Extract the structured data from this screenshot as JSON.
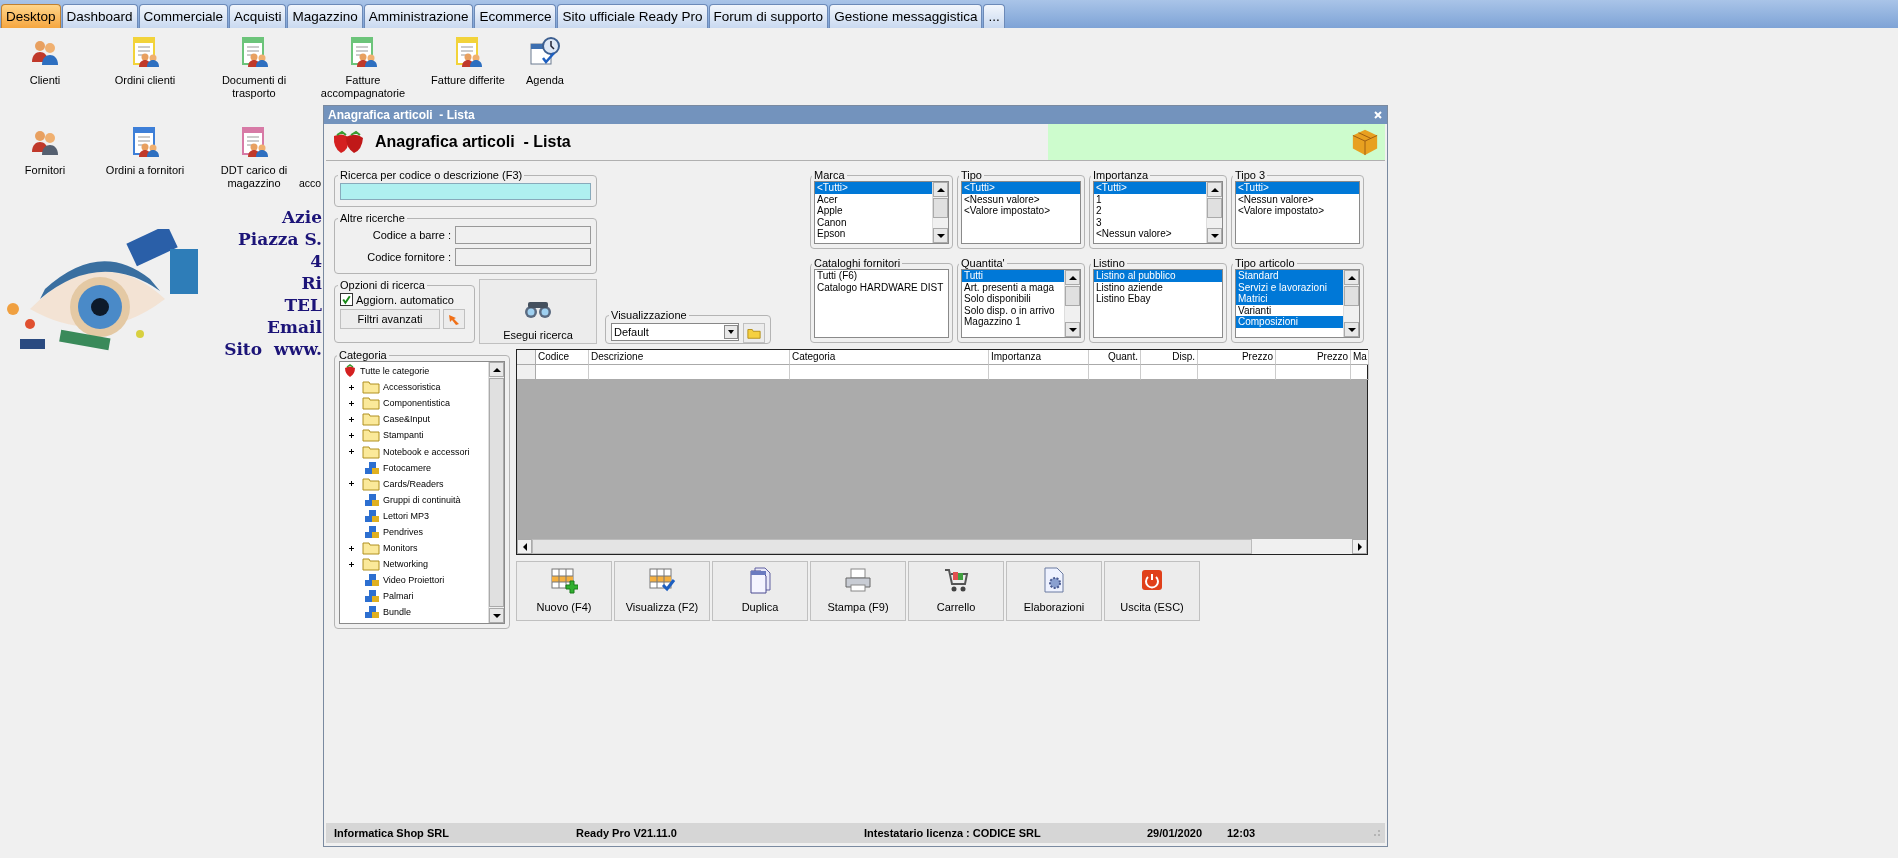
{
  "tabs": [
    {
      "label": "Desktop",
      "selected": true
    },
    {
      "label": "Dashboard",
      "selected": false
    },
    {
      "label": "Commerciale",
      "selected": false
    },
    {
      "label": "Acquisti",
      "selected": false
    },
    {
      "label": "Magazzino",
      "selected": false
    },
    {
      "label": "Amministrazione",
      "selected": false
    },
    {
      "label": "Ecommerce",
      "selected": false
    },
    {
      "label": "Sito ufficiale Ready Pro",
      "selected": false
    },
    {
      "label": "Forum di supporto",
      "selected": false
    },
    {
      "label": "Gestione messaggistica",
      "selected": false
    },
    {
      "label": "...",
      "selected": false
    }
  ],
  "desktop_icons": [
    {
      "label": "Clienti",
      "kind": "icon"
    },
    {
      "label": "Ordini clienti",
      "kind": "icon"
    },
    {
      "label": "Documenti di trasporto",
      "kind": "icon"
    },
    {
      "label": "Fatture accompagnatorie",
      "kind": "icon"
    },
    {
      "label": "Fatture differite",
      "kind": "icon"
    },
    {
      "label": "Agenda",
      "kind": "icon"
    },
    {
      "label": "Fornitori",
      "kind": "icon"
    },
    {
      "label": "Ordini a fornitori",
      "kind": "icon"
    },
    {
      "label": "DDT carico di magazzino",
      "kind": "icon"
    },
    {
      "label": "acco",
      "kind": "cut"
    }
  ],
  "company_banner": {
    "kind": "picture",
    "lines": [
      "Azie",
      "Piazza S.",
      "4",
      "Ri",
      "TEL",
      "Email",
      "Sito  www."
    ]
  },
  "window": {
    "title": "Anagrafica articoli  - Lista",
    "heading": "Anagrafica articoli  - Lista",
    "search": {
      "label": "Ricerca per codice o descrizione (F3)"
    },
    "other_searches": {
      "label": "Altre ricerche",
      "fields": [
        {
          "label": "Codice a barre :"
        },
        {
          "label": "Codice fornitore :"
        }
      ]
    },
    "options": {
      "label": "Opzioni di ricerca",
      "checkbox": {
        "label": "Aggiorn. automatico",
        "checked": true
      },
      "button": "Filtri avanzati"
    },
    "run_button": "Esegui ricerca",
    "view": {
      "label": "Visualizzazione",
      "value": "Default"
    },
    "filters": [
      {
        "title": "Marca",
        "kind": "scroll",
        "items": [
          {
            "label": "<Tutti>",
            "selected": true
          },
          {
            "label": "Acer",
            "selected": false
          },
          {
            "label": "Apple",
            "selected": false
          },
          {
            "label": "Canon",
            "selected": false
          },
          {
            "label": "Epson",
            "selected": false
          }
        ]
      },
      {
        "title": "Tipo",
        "kind": "plain",
        "items": [
          {
            "label": "<Tutti>",
            "selected": true
          },
          {
            "label": "<Nessun valore>",
            "selected": false
          },
          {
            "label": "<Valore impostato>",
            "selected": false
          }
        ]
      },
      {
        "title": "Importanza",
        "kind": "scroll",
        "items": [
          {
            "label": "<Tutti>",
            "selected": true
          },
          {
            "label": "1",
            "selected": false
          },
          {
            "label": "2",
            "selected": false
          },
          {
            "label": "3",
            "selected": false
          },
          {
            "label": "<Nessun valore>",
            "selected": false
          }
        ]
      },
      {
        "title": "Tipo 3",
        "kind": "plain",
        "items": [
          {
            "label": "<Tutti>",
            "selected": true
          },
          {
            "label": "<Nessun valore>",
            "selected": false
          },
          {
            "label": "<Valore impostato>",
            "selected": false
          }
        ]
      },
      {
        "title": "Cataloghi fornitori",
        "kind": "plain",
        "items": [
          {
            "label": "Tutti (F6)",
            "selected": false
          },
          {
            "label": "Catalogo HARDWARE DIST",
            "selected": false
          }
        ]
      },
      {
        "title": "Quantita'",
        "kind": "scroll",
        "items": [
          {
            "label": "Tutti",
            "selected": true
          },
          {
            "label": "Art. presenti a maga",
            "selected": false
          },
          {
            "label": "Solo disponibili",
            "selected": false
          },
          {
            "label": "Solo disp. o in arrivo",
            "selected": false
          },
          {
            "label": "Magazzino 1",
            "selected": false
          }
        ]
      },
      {
        "title": "Listino",
        "kind": "plain",
        "items": [
          {
            "label": "Listino al pubblico",
            "selected": true
          },
          {
            "label": "Listino aziende",
            "selected": false
          },
          {
            "label": "Listino Ebay",
            "selected": false
          }
        ]
      },
      {
        "title": "Tipo articolo",
        "kind": "scroll",
        "items": [
          {
            "label": "Standard",
            "selected": true
          },
          {
            "label": "Servizi e lavorazioni",
            "selected": true
          },
          {
            "label": "Matrici",
            "selected": true
          },
          {
            "label": "Varianti",
            "selected": false
          },
          {
            "label": "Composizioni",
            "selected": true
          }
        ]
      }
    ],
    "category": {
      "label": "Categoria",
      "tree": [
        {
          "label": "Tutte le categorie",
          "kind": "root",
          "children": [
            {
              "label": "Accessoristica",
              "kind": "folder",
              "expanded": false
            },
            {
              "label": "Componentistica",
              "kind": "folder",
              "expanded": false
            },
            {
              "label": "Case&Input",
              "kind": "folder",
              "expanded": false
            },
            {
              "label": "Stampanti",
              "kind": "folder",
              "expanded": false
            },
            {
              "label": "Notebook e accessori",
              "kind": "folder",
              "expanded": false
            },
            {
              "label": "Fotocamere",
              "kind": "leaf"
            },
            {
              "label": "Cards/Readers",
              "kind": "folder",
              "expanded": false
            },
            {
              "label": "Gruppi di continuità",
              "kind": "leaf"
            },
            {
              "label": "Lettori MP3",
              "kind": "leaf"
            },
            {
              "label": "Pendrives",
              "kind": "leaf"
            },
            {
              "label": "Monitors",
              "kind": "folder",
              "expanded": false
            },
            {
              "label": "Networking",
              "kind": "folder",
              "expanded": false
            },
            {
              "label": "Video Proiettori",
              "kind": "leaf"
            },
            {
              "label": "Palmari",
              "kind": "leaf"
            },
            {
              "label": "Bundle",
              "kind": "leaf"
            }
          ]
        }
      ]
    },
    "table": {
      "columns": [
        {
          "label": "Codice",
          "kind": "text"
        },
        {
          "label": "Descrizione",
          "kind": "text"
        },
        {
          "label": "Categoria",
          "kind": "text"
        },
        {
          "label": "Importanza",
          "kind": "text"
        },
        {
          "label": "Quant.",
          "kind": "number"
        },
        {
          "label": "Disp.",
          "kind": "number"
        },
        {
          "label": "Prezzo",
          "kind": "number"
        },
        {
          "label": "Prezzo",
          "kind": "number"
        },
        {
          "label": "Ma",
          "kind": "text"
        }
      ]
    },
    "buttons": [
      "Nuovo (F4)",
      "Visualizza (F2)",
      "Duplica",
      "Stampa (F9)",
      "Carrello",
      "Elaborazioni",
      "Uscita (ESC)"
    ],
    "status_bar": {
      "company": "Informatica Shop SRL",
      "version": "Ready Pro V21.11.0",
      "license": "Intestatario licenza : CODICE SRL",
      "date": "29/01/2020",
      "time": "12:03"
    }
  }
}
